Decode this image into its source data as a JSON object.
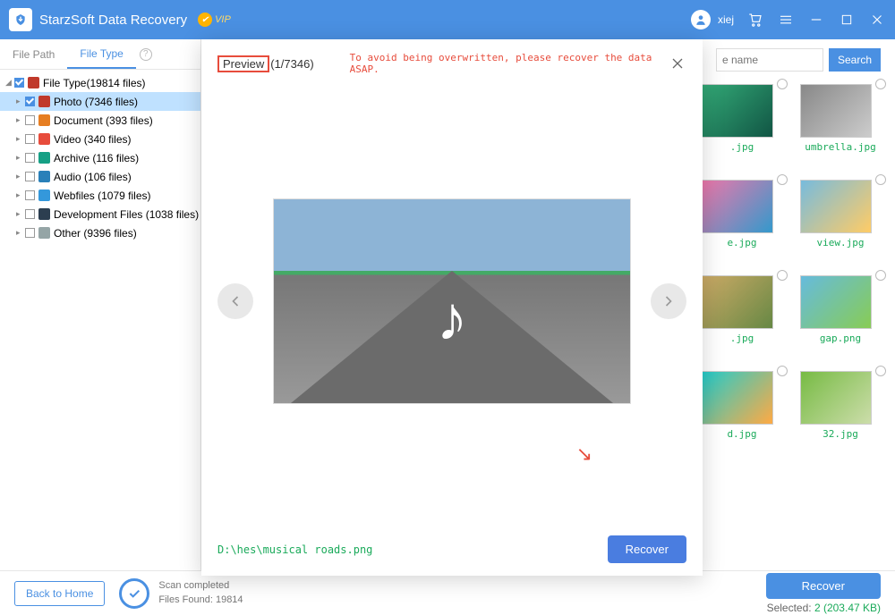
{
  "titlebar": {
    "app_name": "StarzSoft Data Recovery",
    "vip_label": "VIP",
    "username": "xiej"
  },
  "sidebar": {
    "tabs": {
      "path": "File Path",
      "type": "File Type"
    },
    "root": "File Type(19814 files)",
    "items": [
      {
        "name": "Photo",
        "count": "(7346 files)",
        "color": "#c0392b",
        "checked": true
      },
      {
        "name": "Document",
        "count": "(393 files)",
        "color": "#e67e22",
        "checked": false
      },
      {
        "name": "Video",
        "count": "(340 files)",
        "color": "#e74c3c",
        "checked": false
      },
      {
        "name": "Archive",
        "count": "(116 files)",
        "color": "#16a085",
        "checked": false
      },
      {
        "name": "Audio",
        "count": "(106 files)",
        "color": "#2980b9",
        "checked": false
      },
      {
        "name": "Webfiles",
        "count": "(1079 files)",
        "color": "#3498db",
        "checked": false
      },
      {
        "name": "Development Files",
        "count": "(1038 files)",
        "color": "#2c3e50",
        "checked": false
      },
      {
        "name": "Other",
        "count": "(9396 files)",
        "color": "#95a5a6",
        "checked": false
      }
    ]
  },
  "search": {
    "placeholder": "e name",
    "button": "Search"
  },
  "thumbs": [
    {
      "name": ".jpg",
      "g": "linear-gradient(135deg,#3a7,#154)"
    },
    {
      "name": "umbrella.jpg",
      "g": "linear-gradient(135deg,#888,#ccc)"
    },
    {
      "name": "e.jpg",
      "g": "linear-gradient(135deg,#e7a,#39c)"
    },
    {
      "name": "view.jpg",
      "g": "linear-gradient(135deg,#7bd,#fc6)"
    },
    {
      "name": ".jpg",
      "g": "linear-gradient(135deg,#ca6,#684)"
    },
    {
      "name": "gap.png",
      "g": "linear-gradient(135deg,#6bd,#8c5)"
    },
    {
      "name": "d.jpg",
      "g": "linear-gradient(135deg,#2cc,#fa4)"
    },
    {
      "name": "32.jpg",
      "g": "linear-gradient(135deg,#7b4,#cda)"
    }
  ],
  "footer": {
    "back": "Back to Home",
    "scan1": "Scan completed",
    "scan2": "Files Found: 19814",
    "selected_label": "Selected: ",
    "selected_value": "2 (203.47 KB)",
    "recover": "Recover"
  },
  "modal": {
    "preview_label": "Preview",
    "count": "(1/7346)",
    "warning": "To avoid being overwritten, please recover the data ASAP.",
    "filepath": "D:\\hes\\musical roads.png",
    "recover": "Recover"
  }
}
